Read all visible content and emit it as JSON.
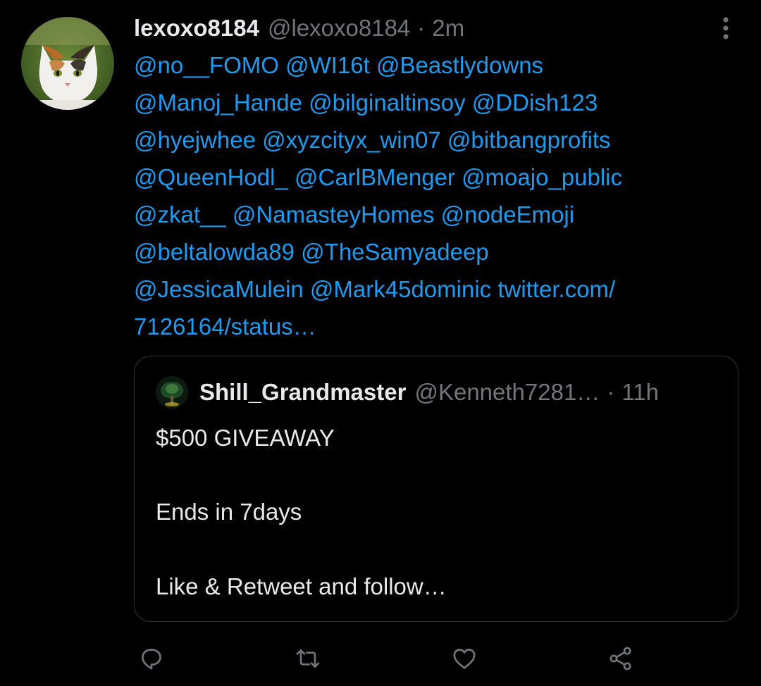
{
  "tweet": {
    "display_name": "lexoxo8184",
    "handle": "@lexoxo8184",
    "separator": "·",
    "time": "2m",
    "lines": [
      [
        "@no__FOMO",
        "@WI16t",
        "@Beastlydowns"
      ],
      [
        "@Manoj_Hande",
        "@bilginaltinsoy",
        "@DDish123"
      ],
      [
        "@hyejwhee",
        "@xyzcityx_win07",
        "@bitbangprofits"
      ],
      [
        "@QueenHodl_",
        "@CarlBMenger",
        "@moajo_public"
      ],
      [
        "@zkat__",
        "@NamasteyHomes",
        "@nodeEmoji"
      ],
      [
        "@beltalowda89",
        "@TheSamyadeep"
      ],
      [
        "@JessicaMulein",
        "@Mark45dominic",
        "twitter.com/"
      ],
      [
        "7126164/status…"
      ]
    ]
  },
  "quoted": {
    "display_name": "Shill_Grandmaster",
    "handle": "@Kenneth7281…",
    "separator": "·",
    "time": "11h",
    "text_lines": [
      "$500 GIVEAWAY",
      "",
      "Ends in 7days",
      "",
      "Like & Retweet and follow…"
    ]
  },
  "icons": {
    "more": "more-vertical-icon",
    "reply": "reply-icon",
    "retweet": "retweet-icon",
    "like": "heart-icon",
    "share": "share-icon"
  },
  "colors": {
    "background": "#000000",
    "text": "#e7e9ea",
    "secondary": "#71767b",
    "link": "#1d9bf0",
    "border": "#2f3336"
  }
}
